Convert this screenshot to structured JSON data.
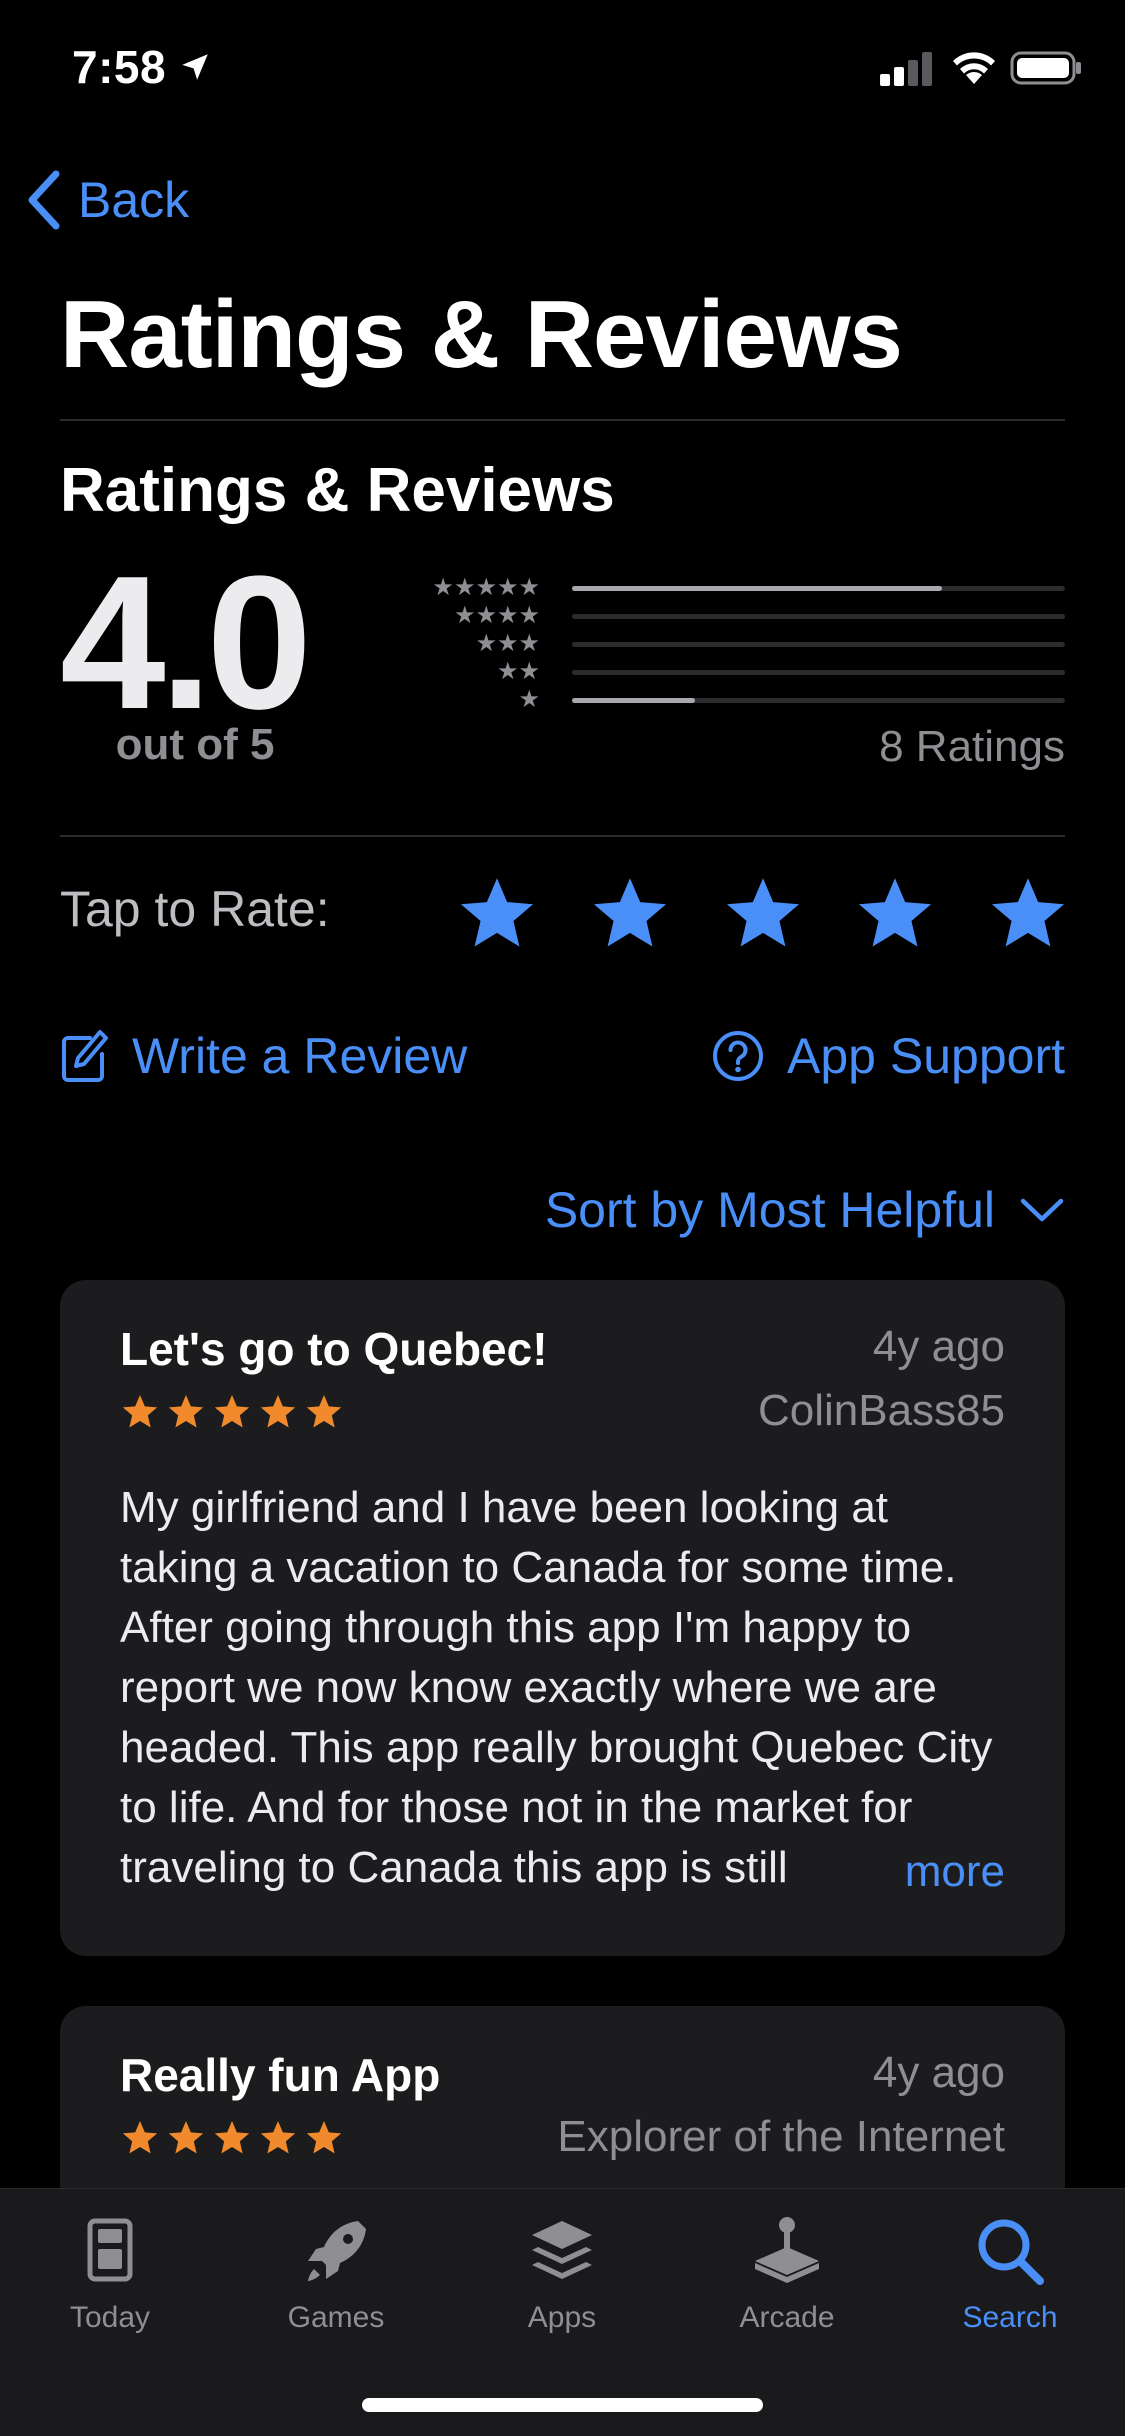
{
  "status_bar": {
    "time": "7:58"
  },
  "nav": {
    "back_label": "Back"
  },
  "page_title": "Ratings & Reviews",
  "summary": {
    "section_title": "Ratings & Reviews",
    "average": "4.0",
    "out_of": "out of 5",
    "ratings_count": "8 Ratings",
    "histogram": [
      {
        "stars": 5,
        "fraction": 0.75
      },
      {
        "stars": 4,
        "fraction": 0.0
      },
      {
        "stars": 3,
        "fraction": 0.0
      },
      {
        "stars": 2,
        "fraction": 0.0
      },
      {
        "stars": 1,
        "fraction": 0.25
      }
    ]
  },
  "rate": {
    "label": "Tap to Rate:",
    "star_count": 5
  },
  "actions": {
    "write_review": "Write a Review",
    "app_support": "App Support"
  },
  "sort": {
    "label": "Sort by Most Helpful"
  },
  "reviews": [
    {
      "title": "Let's go to Quebec!",
      "date": "4y ago",
      "author": "ColinBass85",
      "stars": 5,
      "body": "My girlfriend and I have been looking at taking a vacation to Canada for some time. After going through this app I'm happy to report we now know exactly where we are headed. This app really brought Quebec City to life. And for those not in the market for traveling to Canada this app is still",
      "more_label": "more"
    },
    {
      "title": "Really fun App",
      "date": "4y ago",
      "author": "Explorer of the Internet",
      "stars": 5
    }
  ],
  "tab_bar": {
    "tabs": [
      {
        "label": "Today",
        "icon": "today-icon"
      },
      {
        "label": "Games",
        "icon": "rocket-icon"
      },
      {
        "label": "Apps",
        "icon": "layers-icon"
      },
      {
        "label": "Arcade",
        "icon": "joystick-icon"
      },
      {
        "label": "Search",
        "icon": "search-icon"
      }
    ],
    "active": "Search"
  },
  "colors": {
    "accent": "#4a8ff8",
    "review_star": "#f08a2c",
    "background": "#000000",
    "card": "#1c1c1e"
  }
}
